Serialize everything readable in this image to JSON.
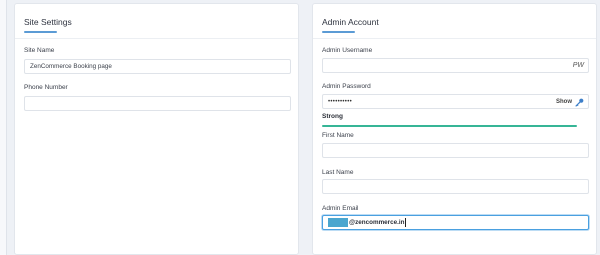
{
  "site_settings": {
    "title": "Site Settings",
    "site_name_label": "Site Name",
    "site_name_value": "ZenCommerce Booking page",
    "phone_label": "Phone Number",
    "phone_value": ""
  },
  "admin_account": {
    "title": "Admin Account",
    "username_label": "Admin Username",
    "username_value": "",
    "generate_button": "PW",
    "password_label": "Admin Password",
    "password_value": "••••••••••",
    "show_label": "Show",
    "strength_text": "Strong",
    "strength_level": 1.0,
    "strength_color": "#36b596",
    "first_name_label": "First Name",
    "first_name_value": "",
    "last_name_label": "Last Name",
    "last_name_value": "",
    "email_label": "Admin Email",
    "email_domain": "@zencommerce.in",
    "email_selection_color": "#4aa6cf"
  },
  "colors": {
    "accent": "#5b9bd5",
    "focus_border": "#4aa0e0",
    "background": "#eef1f6"
  }
}
